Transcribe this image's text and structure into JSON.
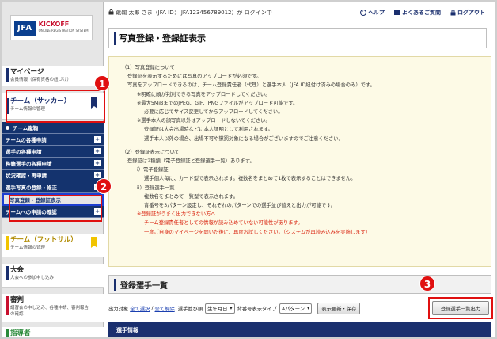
{
  "logo": {
    "jfa": "JFA",
    "kickoff": "KICKOFF",
    "kickoff_sub": "ONLINE REGISTRATION SYSTEM"
  },
  "header": {
    "login_text": "蹴鞠 太郎 さま（JFA ID： JFA123456789012）が ログイン中",
    "help": "ヘルプ",
    "faq": "よくあるご質問",
    "logout": "ログアウト"
  },
  "sidebar": {
    "mypage": {
      "title": "マイページ",
      "sub": "会員情報（保有資格の紐づけ）"
    },
    "team_soccer": {
      "title": "チーム（サッカー）",
      "sub": "チーム情報の管理"
    },
    "sub_top": "チーム蹴鞠",
    "sub_items": [
      {
        "label": "チームの各種申請"
      },
      {
        "label": "選手の各種申請"
      },
      {
        "label": "移籍選手の各種申請"
      },
      {
        "label": "状況確認・再申請"
      },
      {
        "label": "選手写真の登録・修正"
      },
      {
        "label": "写真登録・登録証表示"
      },
      {
        "label": "チームへの申請の確認"
      }
    ],
    "team_futsal": {
      "title": "チーム（フットサル）",
      "sub": "チーム情報の管理"
    },
    "taikai": {
      "title": "大会",
      "sub": "大会への参加申し込み"
    },
    "referee": {
      "title": "審判",
      "sub": "講習会の申し込み、各種申請、審判報告の確認"
    },
    "coach": {
      "title": "指導者",
      "sub": ""
    }
  },
  "badges": [
    "1",
    "2",
    "3"
  ],
  "page_title": "写真登録・登録証表示",
  "notice_lines": [
    {
      "text": "（1）写真登録について",
      "indent": "i1",
      "red": false
    },
    {
      "text": "登録証を表示するためには写真のアップロードが必須です。",
      "indent": "i2",
      "red": false
    },
    {
      "text": "写真をアップロードできるのは、チーム登録責任者（代理）と選手本人（JFA ID紐付け済みの場合のみ）です。",
      "indent": "i2",
      "red": false
    },
    {
      "text": "※明確に顔が判別できる写真をアップロードしてください。",
      "indent": "i3",
      "red": false
    },
    {
      "text": "※最大5MiBまでのJPEG、GIF、PNGファイルがアップロード可能です。",
      "indent": "i3",
      "red": false
    },
    {
      "text": "必要に応じてサイズ変更してからアップロードしてください。",
      "indent": "i4",
      "red": false
    },
    {
      "text": "※選手本人の顔写真以外はアップロードしないでください。",
      "indent": "i3",
      "red": false
    },
    {
      "text": "登録証は大会出場時などに本人証明として利用されます。",
      "indent": "i4",
      "red": false
    },
    {
      "text": "選手本人以外の場合、出場不可や懲罰対象になる場合がございますのでご注意ください。",
      "indent": "i4",
      "red": false
    },
    {
      "text": "",
      "indent": "i1",
      "red": false
    },
    {
      "text": "（2）登録証表示について",
      "indent": "i1",
      "red": false
    },
    {
      "text": "登録証は2種類（電子登録証と登録選手一覧）あります。",
      "indent": "i2",
      "red": false
    },
    {
      "text": "i）電子登録証",
      "indent": "i3",
      "red": false
    },
    {
      "text": "選手個人毎に、カード型で表示されます。複数名をまとめて1枚で表示することはできません。",
      "indent": "i4",
      "red": false
    },
    {
      "text": "ii）登録選手一覧",
      "indent": "i3",
      "red": false
    },
    {
      "text": "複数名をまとめて一覧型で表示されます。",
      "indent": "i4",
      "red": false
    },
    {
      "text": "背番号を3パターン設定し、それぞれのパターンでの選手並び替えと出力が可能です。",
      "indent": "i4",
      "red": false
    },
    {
      "text": "※登録証がうまく出力できない方へ",
      "indent": "i3",
      "red": true
    },
    {
      "text": "チーム登録責任者としての情報が読み込めていない可能性があります。",
      "indent": "i4",
      "red": true
    },
    {
      "text": "一度ご自身のマイページを開いた後に、再度お試しください。（システムが再読み込みを実施します）",
      "indent": "i4",
      "red": true
    }
  ],
  "section_title": "登録選手一覧",
  "controls": {
    "target_label": "出力対象",
    "select_all": "全て選択",
    "sep": "/",
    "deselect_all": "全て解除",
    "sort_label": "選手並び順",
    "sort_value": "生年月日",
    "num_label": "背番号表示タイプ",
    "num_value": "Aパターン",
    "refresh_save": "表示更新・保存",
    "output_button": "登録選手一覧出力"
  },
  "info_bar": "選手情報"
}
